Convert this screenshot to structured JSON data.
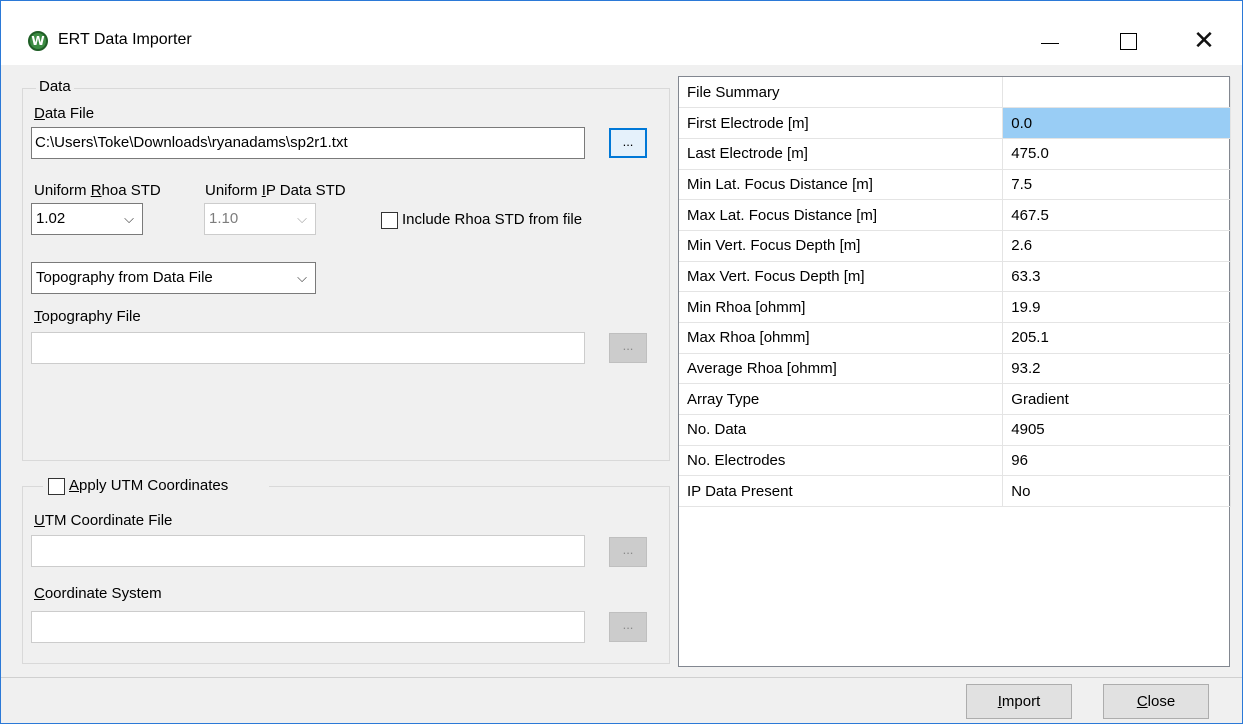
{
  "window": {
    "title": "ERT Data Importer",
    "icon_letter": "W",
    "controls": {
      "minimize": "minimize-icon",
      "maximize": "maximize-icon",
      "close": "close-icon"
    }
  },
  "data_group": {
    "legend": "Data",
    "data_file_label_first": "D",
    "data_file_label_rest": "ata File",
    "data_file_value": "C:\\Users\\Toke\\Downloads\\ryanadams\\sp2r1.txt",
    "browse_label": "...",
    "rhoa_std_label_pre": "Uniform ",
    "rhoa_std_label_ul": "R",
    "rhoa_std_label_post": "hoa STD",
    "rhoa_std_value": "1.02",
    "ip_std_label_pre": "Uniform ",
    "ip_std_label_ul": "I",
    "ip_std_label_post": "P Data STD",
    "ip_std_value": "1.10",
    "include_rhoa_label": "Include Rhoa STD from file",
    "include_rhoa_checked": false,
    "topography_select_value": "Topography from Data File",
    "topography_file_label_first": "T",
    "topography_file_label_rest": "opography File",
    "topography_file_value": ""
  },
  "utm_group": {
    "apply_label_ul": "A",
    "apply_label_rest": "pply UTM Coordinates",
    "apply_checked": false,
    "utm_file_label_first": "U",
    "utm_file_label_rest": "TM Coordinate File",
    "utm_file_value": "",
    "coord_system_label_first": "C",
    "coord_system_label_rest": "oordinate System",
    "coord_system_value": ""
  },
  "summary": {
    "header": "File Summary",
    "rows": [
      {
        "key": "First Electrode [m]",
        "value": "0.0"
      },
      {
        "key": "Last Electrode [m]",
        "value": "475.0"
      },
      {
        "key": "Min Lat. Focus Distance [m]",
        "value": "7.5"
      },
      {
        "key": "Max Lat. Focus Distance [m]",
        "value": "467.5"
      },
      {
        "key": "Min Vert. Focus Depth [m]",
        "value": "2.6"
      },
      {
        "key": "Max Vert. Focus Depth [m]",
        "value": "63.3"
      },
      {
        "key": "Min Rhoa [ohmm]",
        "value": "19.9"
      },
      {
        "key": "Max Rhoa [ohmm]",
        "value": "205.1"
      },
      {
        "key": "Average Rhoa [ohmm]",
        "value": "93.2"
      },
      {
        "key": "Array Type",
        "value": "Gradient"
      },
      {
        "key": "No. Data",
        "value": "4905"
      },
      {
        "key": "No. Electrodes",
        "value": "96"
      },
      {
        "key": "IP Data Present",
        "value": "No"
      }
    ]
  },
  "buttons": {
    "import_ul": "I",
    "import_rest": "mport",
    "close_ul": "C",
    "close_rest": "lose"
  },
  "colors": {
    "window_border": "#2b79d7",
    "selection": "#99cdf5",
    "app_icon": "#3c8c43"
  }
}
